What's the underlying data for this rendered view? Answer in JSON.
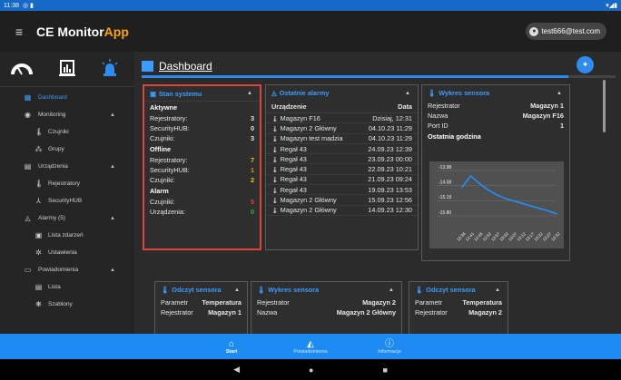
{
  "statusbar": {
    "time": "11:38",
    "left_icons": "◎ ▮",
    "right_icons": "▾◢▮"
  },
  "appbar": {
    "menu_icon": "menu-icon",
    "title_main": "CE Monitor",
    "title_accent": "App",
    "user": "test666@test.com",
    "colors": {
      "accent": "#f7a21b"
    }
  },
  "sidebar": {
    "items": [
      {
        "label": "Dashboard",
        "icon": "▦",
        "icon_name": "dashboard-icon",
        "active": true
      },
      {
        "label": "Monitoring",
        "icon": "◉",
        "icon_name": "eye-icon",
        "caret": "▲"
      },
      {
        "label": "Czujniki",
        "icon": "🌡",
        "icon_name": "thermometer-icon",
        "sub": true
      },
      {
        "label": "Grupy",
        "icon": "⁂",
        "icon_name": "groups-icon",
        "sub": true
      },
      {
        "label": "Urządzenia",
        "icon": "▤",
        "icon_name": "devices-icon",
        "caret": "▲"
      },
      {
        "label": "Rejestratory",
        "icon": "🌡",
        "icon_name": "recorder-icon",
        "sub": true
      },
      {
        "label": "SecurityHUB",
        "icon": "⅄",
        "icon_name": "hub-icon",
        "sub": true
      },
      {
        "label": "Alarmy (5)",
        "icon": "◬",
        "icon_name": "alarm-icon",
        "caret": "▲"
      },
      {
        "label": "Lista zdarzeń",
        "icon": "▣",
        "icon_name": "event-list-icon",
        "sub": true
      },
      {
        "label": "Ustawienia",
        "icon": "✲",
        "icon_name": "settings-icon",
        "sub": true
      },
      {
        "label": "Powiadomienia",
        "icon": "▭",
        "icon_name": "notifications-icon",
        "caret": "▲"
      },
      {
        "label": "Lista",
        "icon": "▤",
        "icon_name": "list-icon",
        "sub": true
      },
      {
        "label": "Szablony",
        "icon": "❋",
        "icon_name": "templates-icon",
        "sub": true
      }
    ]
  },
  "dashboard": {
    "title": "Dashboard",
    "progress": 0.9
  },
  "stan": {
    "title": "Stan systemu",
    "aktywne_label": "Aktywne",
    "aktywne": [
      {
        "label": "Rejestratory:",
        "value": "3"
      },
      {
        "label": "SecurityHUB:",
        "value": "0"
      },
      {
        "label": "Czujniki:",
        "value": "3"
      }
    ],
    "offline_label": "Offline",
    "offline": [
      {
        "label": "Rejestratory:",
        "value": "7"
      },
      {
        "label": "SecurityHUB:",
        "value": "1"
      },
      {
        "label": "Czujniki:",
        "value": "2"
      }
    ],
    "alarm_label": "Alarm",
    "alarm": [
      {
        "label": "Czujniki:",
        "value": "5"
      },
      {
        "label": "Urządzenia:",
        "value": "0"
      }
    ]
  },
  "alarms": {
    "title": "Ostatnie alarmy",
    "col_device": "Urządzenie",
    "col_date": "Data",
    "rows": [
      {
        "device": "Magazyn F16",
        "date": "Dzisiaj, 12:31"
      },
      {
        "device": "Magazyn 2 Główny",
        "date": "04.10.23 11:29"
      },
      {
        "device": "Magazyn test madzia",
        "date": "04.10.23 11:29"
      },
      {
        "device": "Regał 43",
        "date": "24.09.23 12:39"
      },
      {
        "device": "Regał 43",
        "date": "23.09.23 00:00"
      },
      {
        "device": "Regał 43",
        "date": "22.09.23 10:21"
      },
      {
        "device": "Regał 43",
        "date": "21.09.23 09:24"
      },
      {
        "device": "Regał 43",
        "date": "19.09.23 13:53"
      },
      {
        "device": "Magazyn 2 Główny",
        "date": "15.09.23 12:56"
      },
      {
        "device": "Magazyn 2 Główny",
        "date": "14.09.23 12:30"
      }
    ]
  },
  "wykres1": {
    "title": "Wykres sensora",
    "rows": [
      {
        "label": "Rejestrator",
        "value": "Magazyn 1"
      },
      {
        "label": "Nazwa",
        "value": "Magazyn F16"
      },
      {
        "label": "Port ID",
        "value": "1"
      }
    ],
    "subtitle": "Ostatnia godzina"
  },
  "chart_data": {
    "type": "line",
    "ylim": [
      -15.8,
      -13.98
    ],
    "yticks": [
      "-13.98",
      "-14.58",
      "-15.19",
      "-15.80"
    ],
    "x": [
      "12:36",
      "12:41",
      "12:46",
      "12:52",
      "12:57",
      "13:02",
      "13:07",
      "13:12",
      "13:17",
      "13:22",
      "13:27",
      "13:32"
    ],
    "values": [
      -14.65,
      -14.2,
      -14.5,
      -14.75,
      -14.95,
      -15.1,
      -15.2,
      -15.3,
      -15.4,
      -15.5,
      -15.6,
      -15.72
    ],
    "line_color": "#1f8fff",
    "grid": true
  },
  "odczyt1": {
    "title": "Odczyt sensora",
    "rows": [
      {
        "label": "Parametr",
        "value": "Temperatura"
      },
      {
        "label": "Rejestrator",
        "value": "Magazyn 1"
      }
    ]
  },
  "wykres2": {
    "title": "Wykres sensora",
    "rows": [
      {
        "label": "Rejestrator",
        "value": "Magazyn 2"
      },
      {
        "label": "Nazwa",
        "value": "Magazyn 2 Główny"
      }
    ]
  },
  "odczyt2": {
    "title": "Odczyt sensora",
    "rows": [
      {
        "label": "Parametr",
        "value": "Temperatura"
      },
      {
        "label": "Rejestrator",
        "value": "Magazyn 2"
      }
    ]
  },
  "bottomnav": [
    {
      "label": "Start",
      "icon": "⌂",
      "icon_name": "home-icon",
      "active": true
    },
    {
      "label": "Powiadomienia",
      "icon": "◭",
      "icon_name": "bell-icon"
    },
    {
      "label": "Informacje",
      "icon": "ⓘ",
      "icon_name": "info-icon"
    }
  ],
  "sysnav": {
    "back": "◀",
    "home": "●",
    "recents": "■"
  }
}
